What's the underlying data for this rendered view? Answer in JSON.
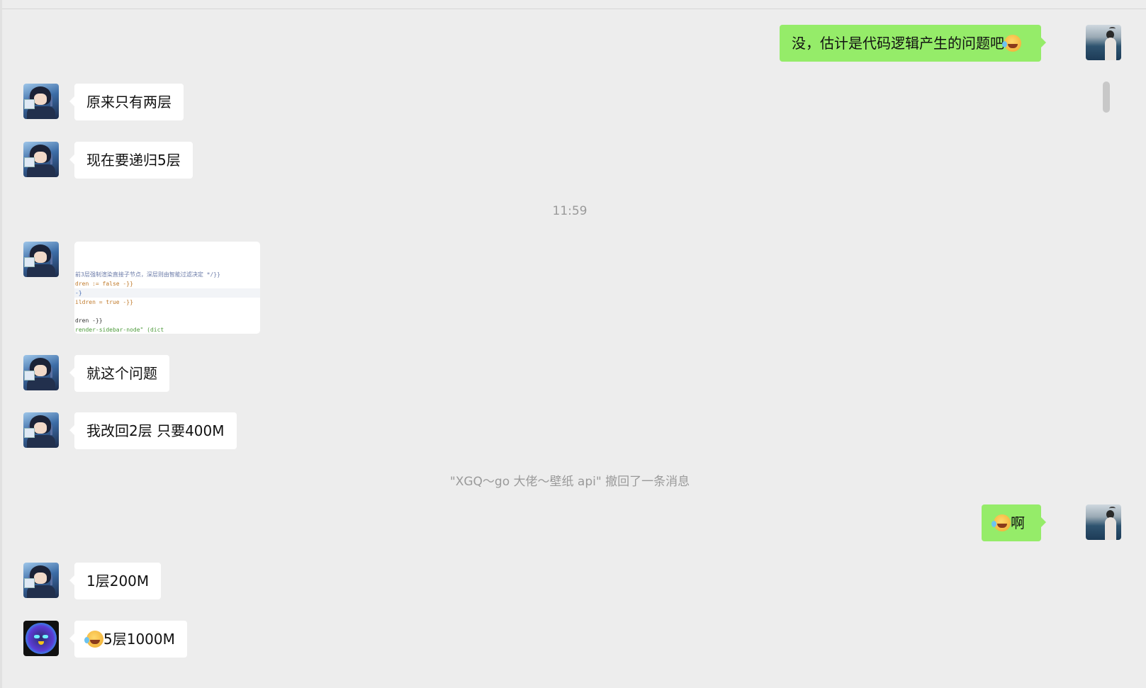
{
  "colors": {
    "background": "#ededed",
    "self_bubble": "#95ec69",
    "other_bubble": "#ffffff",
    "meta_text": "#9a9a9a"
  },
  "icons": {
    "emoji": "rolling-on-floor-laughing-emoji",
    "avatar_self": "sea-photo-avatar",
    "avatar_other": "anime-headset-avatar",
    "avatar_bot": "robot-avatar"
  },
  "messages": [
    {
      "sender": "self",
      "text": "没，估计是代码逻辑产生的问题吧"
    },
    {
      "sender": "other",
      "text": "原来只有两层"
    },
    {
      "sender": "other",
      "text": "现在要递归5层"
    },
    {
      "sender": "other",
      "type": "image",
      "image_lines": [
        {
          "text": "前3层强制渲染直接子节点，深层则由智能过滤决定 */}}",
          "style": "comment"
        },
        {
          "text": "dren := false -}}",
          "style": "kw"
        },
        {
          "text": "-}",
          "style": "blue"
        },
        {
          "text": "ildren = true -}}",
          "style": "kw"
        },
        {
          "text": "",
          "style": "blue"
        },
        {
          "text": "dren -}}",
          "style": "plain"
        },
        {
          "text": "render-sidebar-node\" (dict",
          "style": "str"
        }
      ]
    },
    {
      "sender": "other",
      "text": "就这个问题"
    },
    {
      "sender": "other",
      "text": "我改回2层 只要400M"
    },
    {
      "sender": "self",
      "text": "啊"
    },
    {
      "sender": "other",
      "text": "1层200M"
    },
    {
      "sender": "bot",
      "text": "5层1000M"
    }
  ],
  "timestamp": "11:59",
  "system_notice": "\"XGQ～go 大佬～壁纸 api\" 撤回了一条消息"
}
